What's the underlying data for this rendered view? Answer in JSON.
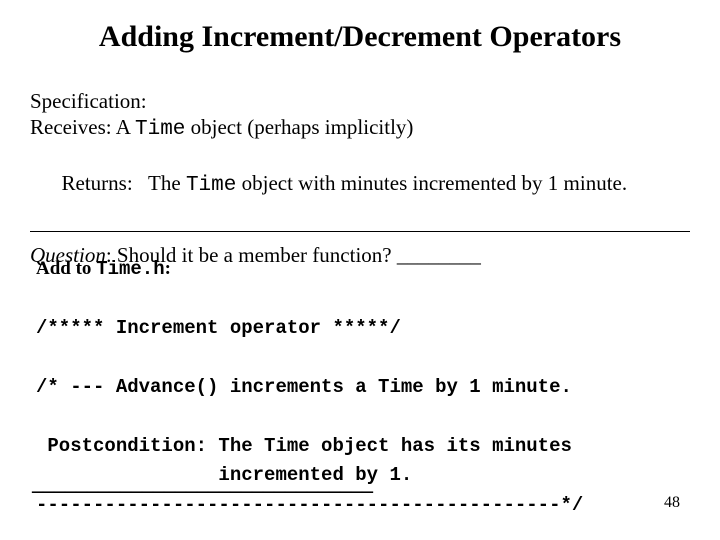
{
  "title": "Adding Increment/Decrement Operators",
  "spec": {
    "label": "Specification:",
    "receives_pre": "Receives: A ",
    "receives_code": "Time",
    "receives_post": " object (perhaps implicitly)",
    "returns_pre": "Returns:   The ",
    "returns_code": "Time",
    "returns_post": " object with minutes incremented by 1 minute."
  },
  "question": {
    "label": "Question",
    "text": ": Should it be a member function?  ________"
  },
  "code": {
    "addto_pre": "Add to ",
    "addto_code": "Time.h",
    "addto_post": ":",
    "line1": "/***** Increment operator *****/",
    "line2": "/* --- Advance() increments a Time by 1 minute.",
    "line3": " Postcondition: The Time object has its minutes",
    "line4": "                incremented by 1.",
    "line5": "----------------------------------------------*/"
  },
  "blank": "_______________________________",
  "page": "48"
}
